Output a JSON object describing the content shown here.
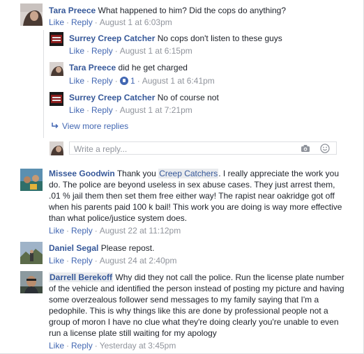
{
  "comments": [
    {
      "author": "Tara Preece",
      "text": "What happened to him? Did the cops do anything?",
      "like": "Like",
      "reply": "Reply",
      "time": "August 1 at 6:03pm"
    },
    {
      "author": "Surrey Creep Catcher",
      "text": "No cops don't listen to these guys",
      "like": "Like",
      "reply": "Reply",
      "time": "August 1 at 6:15pm"
    },
    {
      "author": "Tara Preece",
      "text": "did he get charged",
      "like": "Like",
      "reply": "Reply",
      "reactions": "1",
      "time": "August 1 at 6:41pm"
    },
    {
      "author": "Surrey Creep Catcher",
      "text": "No of course not",
      "like": "Like",
      "reply": "Reply",
      "time": "August 1 at 7:21pm"
    },
    {
      "author": "Missee Goodwin",
      "text_before": "Thank you ",
      "tag": "Creep Catchers",
      "text_after": ". I really appreciate the work you do. The police are beyond useless in sex abuse cases. They just arrest them, .01 % jail them then set them free either way! The rapist near oakridge got off when his parents paid 100 k bail! This work you are doing is way more effective than what police/justice system does.",
      "like": "Like",
      "reply": "Reply",
      "time": "August 22 at 11:12pm"
    },
    {
      "author": "Daniel Segal",
      "text": "Please repost.",
      "like": "Like",
      "reply": "Reply",
      "time": "August 24 at 2:40pm"
    },
    {
      "author": "Darrell Berekoff",
      "text": "Why did they not call the police. Run the license plate number of the vehicle and identified the person instead of posting my picture and having some overzealous follower send messages to my family saying that I'm a pedophile. This is why things like this are done by professional people not a group of moron I have no clue what they're doing clearly you're unable to even run a license plate still waiting for my apology",
      "like": "Like",
      "reply": "Reply",
      "time": "Yesterday at 3:45pm"
    }
  ],
  "view_more_replies": "View more replies",
  "reply_box": {
    "placeholder": "Write a reply..."
  },
  "icons": {
    "reply_arrow": "reply-arrow-icon",
    "camera": "camera-icon",
    "emoji": "emoji-icon",
    "like_reaction": "like-reaction-icon"
  },
  "colors": {
    "link": "#365899",
    "action": "#4267b2",
    "meta": "#90949c",
    "tag_bg": "#e9ebee",
    "border": "#dddfe2"
  }
}
